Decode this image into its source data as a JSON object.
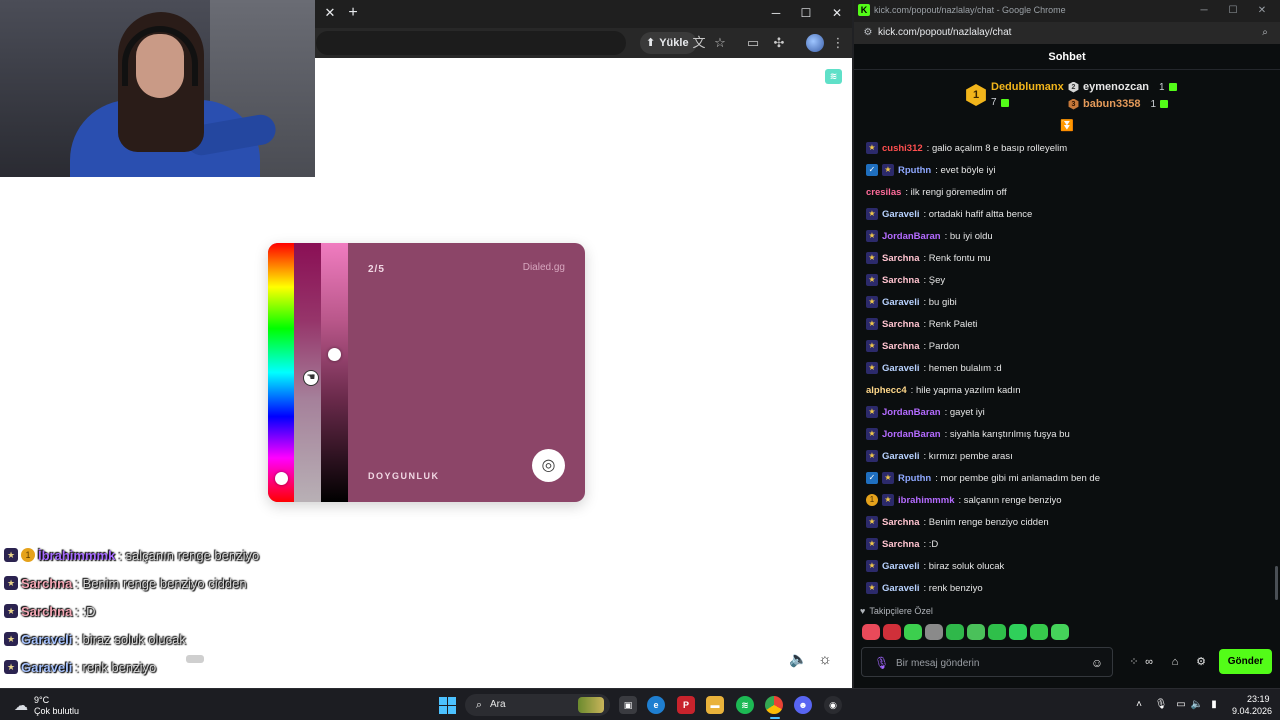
{
  "left_browser": {
    "upload_label": "Yükle",
    "tab_close_glyph": "✕",
    "new_tab_glyph": "+",
    "minimize_glyph": "─",
    "maximize_glyph": "☐",
    "close_glyph": "✕"
  },
  "game_card": {
    "step": "2/5",
    "brand": "Dialed.gg",
    "label": "DOYGUNLUK",
    "background_color": "#8c4568",
    "hue_level": 0.91,
    "saturation_level": 0.52,
    "lightness_level": 0.43
  },
  "overlay_chat": [
    {
      "badges": [
        "sub",
        "coin"
      ],
      "user": "İbrahimmmk",
      "color": "#a66bff",
      "text": " : salçanın renge benziyo"
    },
    {
      "badges": [
        "sub"
      ],
      "user": "Sarchna",
      "color": "#f4a7b5",
      "text": " : Benim renge benziyo cidden"
    },
    {
      "badges": [
        "sub"
      ],
      "user": "Sarchna",
      "color": "#f4a7b5",
      "text": " : :D"
    },
    {
      "badges": [
        "sub"
      ],
      "user": "Garaveli",
      "color": "#a8c4ff",
      "text": " : biraz soluk olucak"
    },
    {
      "badges": [
        "sub"
      ],
      "user": "Garaveli",
      "color": "#a8c4ff",
      "text": " : renk benziyo"
    }
  ],
  "chat_window": {
    "window_title": "kick.com/popout/nazlalay/chat - Google Chrome",
    "url": "kick.com/popout/nazlalay/chat",
    "header_title": "Sohbet",
    "leaderboard": {
      "first": {
        "rank": "1",
        "name": "Dedublumanx",
        "count": "7",
        "color": "#f2b51b"
      },
      "second": {
        "rank": "2",
        "name": "eymenozcan",
        "count": "1",
        "color": "#e6e6e6"
      },
      "third": {
        "rank": "3",
        "name": "babun3358",
        "count": "1",
        "color": "#e49a5a"
      }
    },
    "messages": [
      {
        "badges": [
          "sub"
        ],
        "user": "cushi312",
        "color": "#ff4f4f",
        "text": ": galio açalım 8 e basıp rolleyelim"
      },
      {
        "badges": [
          "verified",
          "sub"
        ],
        "user": "Rputhn",
        "color": "#8fa8ff",
        "text": ": evet böyle iyi"
      },
      {
        "badges": [],
        "user": "cresilas",
        "color": "#ff6b9a",
        "text": ": ilk rengi göremedim off"
      },
      {
        "badges": [
          "sub"
        ],
        "user": "Garaveli",
        "color": "#b8d2ff",
        "text": ": ortadaki hafif altta bence"
      },
      {
        "badges": [
          "sub"
        ],
        "user": "JordanBaran",
        "color": "#b46bff",
        "text": ": bu iyi oldu"
      },
      {
        "badges": [
          "sub"
        ],
        "user": "Sarchna",
        "color": "#ffc3cf",
        "text": ": Renk fontu mu"
      },
      {
        "badges": [
          "sub"
        ],
        "user": "Sarchna",
        "color": "#ffc3cf",
        "text": ": Şey"
      },
      {
        "badges": [
          "sub"
        ],
        "user": "Garaveli",
        "color": "#b8d2ff",
        "text": ": bu gibi"
      },
      {
        "badges": [
          "sub"
        ],
        "user": "Sarchna",
        "color": "#ffc3cf",
        "text": ": Renk Paleti"
      },
      {
        "badges": [
          "sub"
        ],
        "user": "Sarchna",
        "color": "#ffc3cf",
        "text": ": Pardon"
      },
      {
        "badges": [
          "sub"
        ],
        "user": "Garaveli",
        "color": "#b8d2ff",
        "text": ": hemen bulalım :d"
      },
      {
        "badges": [],
        "user": "alphecc4",
        "color": "#ffd88a",
        "text": ": hile yapma yazılım kadın"
      },
      {
        "badges": [
          "sub"
        ],
        "user": "JordanBaran",
        "color": "#b46bff",
        "text": ": gayet iyi"
      },
      {
        "badges": [
          "sub"
        ],
        "user": "JordanBaran",
        "color": "#b46bff",
        "text": ": siyahla karıştırılmış fuşya bu"
      },
      {
        "badges": [
          "sub"
        ],
        "user": "Garaveli",
        "color": "#b8d2ff",
        "text": ": kırmızı pembe arası"
      },
      {
        "badges": [
          "verified",
          "sub"
        ],
        "user": "Rputhn",
        "color": "#8fa8ff",
        "text": ": mor pembe gibi mi anlamadım ben de"
      },
      {
        "badges": [
          "coin",
          "sub"
        ],
        "user": "ibrahimmmk",
        "color": "#b46bff",
        "text": ": salçanın renge benziyo"
      },
      {
        "badges": [
          "sub"
        ],
        "user": "Sarchna",
        "color": "#ffc3cf",
        "text": ": Benim renge benziyo cidden"
      },
      {
        "badges": [
          "sub"
        ],
        "user": "Sarchna",
        "color": "#ffc3cf",
        "text": ": :D"
      },
      {
        "badges": [
          "sub"
        ],
        "user": "Garaveli",
        "color": "#b8d2ff",
        "text": ": biraz soluk olucak"
      },
      {
        "badges": [
          "sub"
        ],
        "user": "Garaveli",
        "color": "#b8d2ff",
        "text": ": renk benziyo"
      }
    ],
    "emote_section_label": "Takipçilere Özel",
    "emote_colors": [
      "#e94a5a",
      "#d0303a",
      "#3ccf4e",
      "#8a8a8a",
      "#2fb84a",
      "#4ac15a",
      "#2fbf4a",
      "#2fd05a",
      "#37c94c",
      "#45d35a"
    ],
    "input_placeholder": "Bir mesaj gönderin",
    "send_label": "Gönder"
  },
  "taskbar": {
    "weather_temp": "9°C",
    "weather_desc": "Çok bulutlu",
    "search_label": "Ara",
    "time": "23:19",
    "date": "9.04.2026"
  }
}
